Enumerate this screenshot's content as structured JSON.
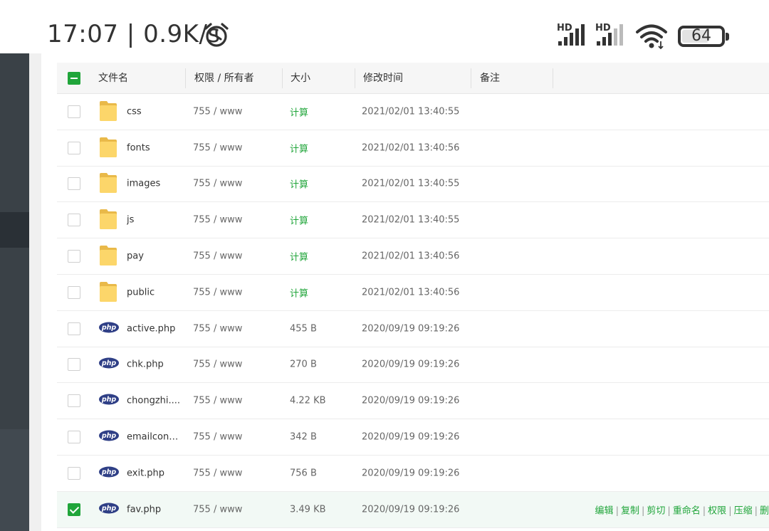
{
  "status_bar": {
    "time": "17:07",
    "separator": "|",
    "net_speed": "0.9K/s",
    "signal1_label": "HD",
    "signal2_label": "HD",
    "battery": "64",
    "battery_level": 0.64
  },
  "table": {
    "headers": {
      "filename": "文件名",
      "permission": "权限 / 所有者",
      "size": "大小",
      "modified": "修改时间",
      "remark": "备注"
    },
    "rows": [
      {
        "name": "css",
        "type": "folder",
        "perm": "755 / www",
        "size": "计算",
        "mtime": "2021/02/01 13:40:55"
      },
      {
        "name": "fonts",
        "type": "folder",
        "perm": "755 / www",
        "size": "计算",
        "mtime": "2021/02/01 13:40:56"
      },
      {
        "name": "images",
        "type": "folder",
        "perm": "755 / www",
        "size": "计算",
        "mtime": "2021/02/01 13:40:55"
      },
      {
        "name": "js",
        "type": "folder",
        "perm": "755 / www",
        "size": "计算",
        "mtime": "2021/02/01 13:40:55"
      },
      {
        "name": "pay",
        "type": "folder",
        "perm": "755 / www",
        "size": "计算",
        "mtime": "2021/02/01 13:40:56"
      },
      {
        "name": "public",
        "type": "folder",
        "perm": "755 / www",
        "size": "计算",
        "mtime": "2021/02/01 13:40:56"
      },
      {
        "name": "active.php",
        "type": "php",
        "perm": "755 / www",
        "size": "455 B",
        "mtime": "2020/09/19 09:19:26"
      },
      {
        "name": "chk.php",
        "type": "php",
        "perm": "755 / www",
        "size": "270 B",
        "mtime": "2020/09/19 09:19:26"
      },
      {
        "name": "chongzhi....",
        "type": "php",
        "perm": "755 / www",
        "size": "4.22 KB",
        "mtime": "2020/09/19 09:19:26"
      },
      {
        "name": "emailconfi...",
        "type": "php",
        "perm": "755 / www",
        "size": "342 B",
        "mtime": "2020/09/19 09:19:26"
      },
      {
        "name": "exit.php",
        "type": "php",
        "perm": "755 / www",
        "size": "756 B",
        "mtime": "2020/09/19 09:19:26"
      },
      {
        "name": "fav.php",
        "type": "php",
        "perm": "755 / www",
        "size": "3.49 KB",
        "mtime": "2020/09/19 09:19:26",
        "selected": true
      }
    ],
    "row_actions": [
      "编辑",
      "复制",
      "剪切",
      "重命名",
      "权限",
      "压缩",
      "删"
    ],
    "php_icon_text": "php"
  },
  "colors": {
    "accent": "#20a53a",
    "sidebar": "#3a4147"
  }
}
